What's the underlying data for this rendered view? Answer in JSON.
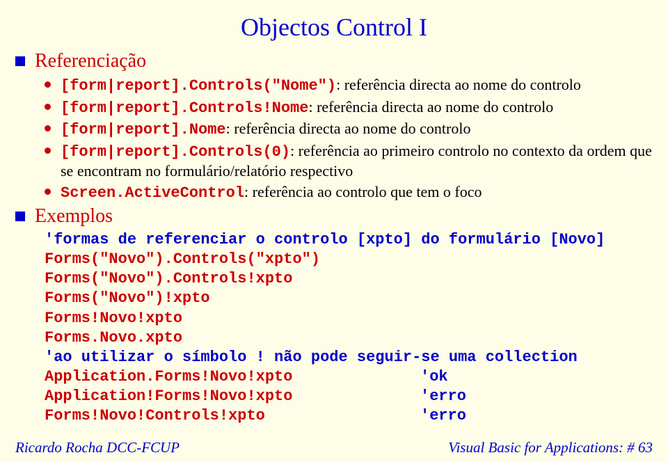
{
  "title": "Objectos Control I",
  "sections": {
    "ref": {
      "heading": "Referenciação",
      "items": [
        {
          "code": "[form|report].Controls(\"Nome\")",
          "desc": ": referência directa ao nome do controlo"
        },
        {
          "code": "[form|report].Controls!Nome",
          "desc": ": referência directa ao nome do controlo"
        },
        {
          "code": "[form|report].Nome",
          "desc": ": referência directa ao nome do controlo"
        },
        {
          "code": "[form|report].Controls(0)",
          "desc": ": referência ao primeiro controlo no contexto da ordem que se encontram no formulário/relatório respectivo"
        },
        {
          "code": "Screen.ActiveControl",
          "desc": ": referência ao controlo que tem o foco"
        }
      ]
    },
    "ex": {
      "heading": "Exemplos",
      "lines": [
        {
          "c1": "'formas de referenciar o controlo [xpto] do formulário [Novo]",
          "c2": ""
        },
        {
          "c1": "Forms(\"Novo\").Controls(\"xpto\")",
          "c2": ""
        },
        {
          "c1": "Forms(\"Novo\").Controls!xpto",
          "c2": ""
        },
        {
          "c1": "Forms(\"Novo\")!xpto",
          "c2": ""
        },
        {
          "c1": "Forms!Novo!xpto",
          "c2": ""
        },
        {
          "c1": "Forms.Novo.xpto",
          "c2": ""
        },
        {
          "c1": "'ao utilizar o símbolo ! não pode seguir-se uma collection",
          "c2": ""
        },
        {
          "c1": "Application.Forms!Novo!xpto",
          "c2": "'ok"
        },
        {
          "c1": "Application!Forms!Novo!xpto",
          "c2": "'erro"
        },
        {
          "c1": "Forms!Novo!Controls!xpto",
          "c2": "'erro"
        }
      ]
    }
  },
  "footer": {
    "left": "Ricardo Rocha DCC-FCUP",
    "right": "Visual Basic for Applications: # 63"
  }
}
